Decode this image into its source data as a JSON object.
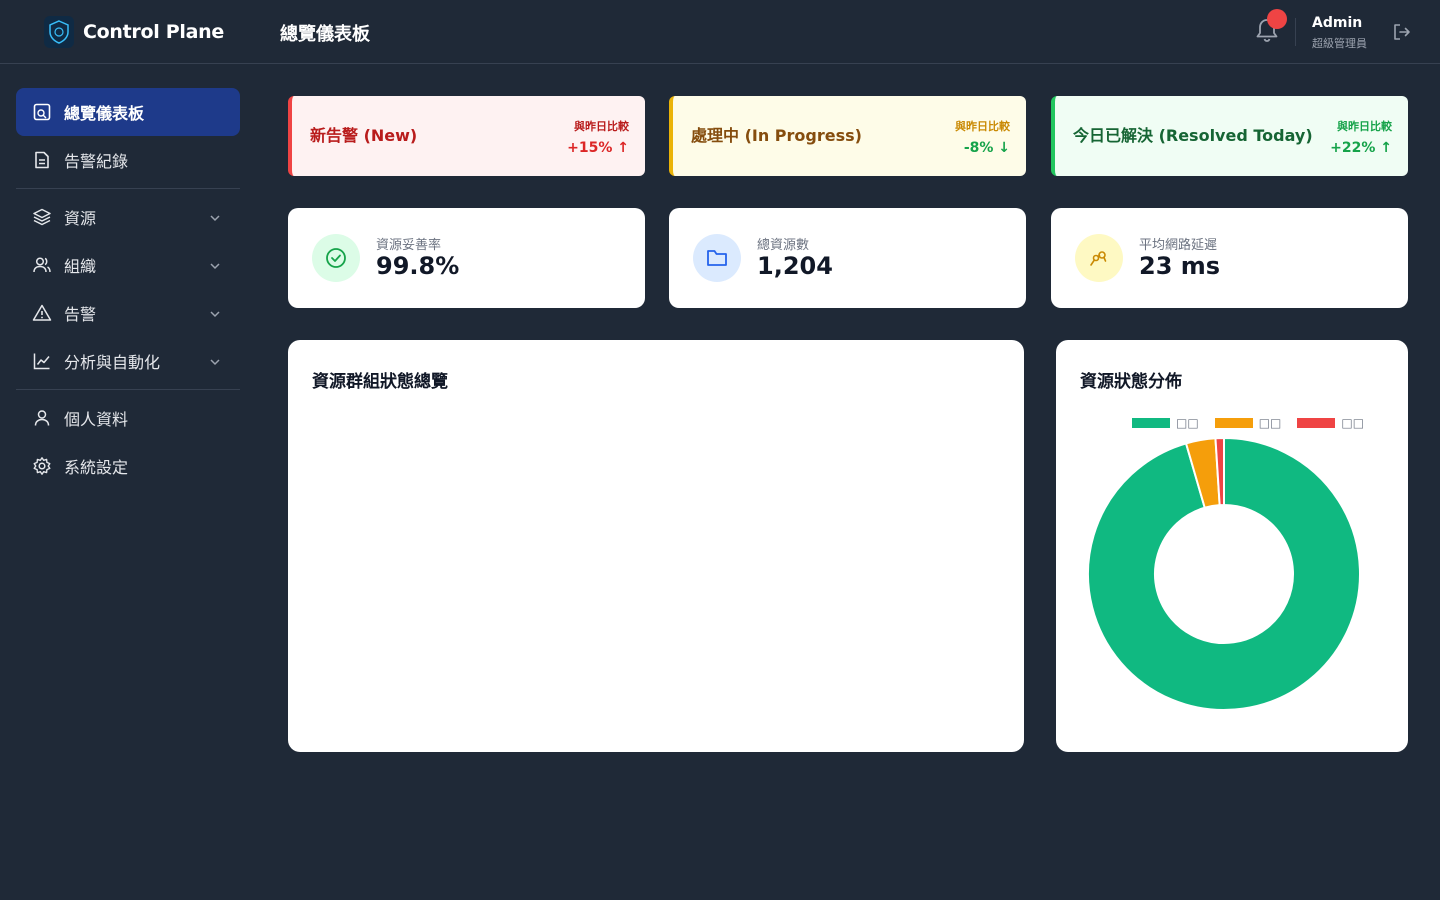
{
  "app": {
    "name": "Control Plane",
    "page_title": "總覽儀表板"
  },
  "user": {
    "name": "Admin",
    "role": "超級管理員"
  },
  "sidebar": {
    "items": [
      {
        "label": "總覽儀表板",
        "icon": "dashboard-icon",
        "active": true
      },
      {
        "label": "告警紀錄",
        "icon": "document-icon"
      },
      {
        "label": "資源",
        "icon": "layers-icon",
        "expandable": true
      },
      {
        "label": "組織",
        "icon": "users-icon",
        "expandable": true
      },
      {
        "label": "告警",
        "icon": "warning-icon",
        "expandable": true
      },
      {
        "label": "分析與自動化",
        "icon": "chart-line-icon",
        "expandable": true
      },
      {
        "label": "個人資料",
        "icon": "user-icon"
      },
      {
        "label": "系統設定",
        "icon": "gear-icon"
      }
    ]
  },
  "alerts": [
    {
      "title": "新告警 (New)",
      "compare_label": "與昨日比較",
      "delta": "+15% ↑",
      "color": "#ef4444"
    },
    {
      "title": "處理中 (In Progress)",
      "compare_label": "與昨日比較",
      "delta": "-8% ↓",
      "color": "#eab308"
    },
    {
      "title": "今日已解決 (Resolved Today)",
      "compare_label": "與昨日比較",
      "delta": "+22% ↑",
      "color": "#22c55e"
    }
  ],
  "stats": [
    {
      "label": "資源妥善率",
      "value": "99.8%",
      "icon": "check-circle-icon"
    },
    {
      "label": "總資源數",
      "value": "1,204",
      "icon": "folder-icon"
    },
    {
      "label": "平均網路延遲",
      "value": "23 ms",
      "icon": "network-icon"
    }
  ],
  "panels": {
    "group_overview_title": "資源群組狀態總覽",
    "distribution_title": "資源狀態分佈"
  },
  "chart_data": {
    "type": "pie",
    "donut": true,
    "legend_position": "top",
    "categories": [
      "□□",
      "□□",
      "□□"
    ],
    "values": [
      95.5,
      3.5,
      1.0
    ],
    "colors": [
      "#10b981",
      "#f59e0b",
      "#ef4444"
    ]
  }
}
